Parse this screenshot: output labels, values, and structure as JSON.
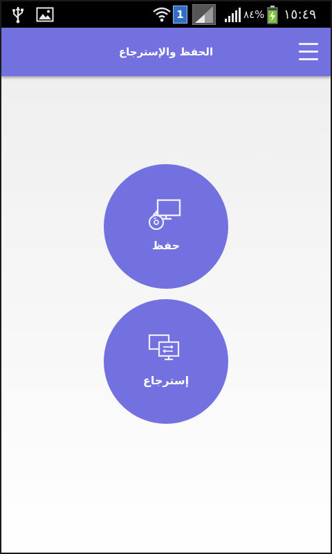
{
  "status_bar": {
    "time": "١٥:٤٩",
    "battery": "٨٤%",
    "notification_badge": "1",
    "icons": [
      "usb-icon",
      "image-icon",
      "wifi-icon",
      "sim-badge-icon",
      "signal-icon",
      "signal-icon",
      "battery-charging-icon"
    ]
  },
  "app_bar": {
    "title": "الحفظ والإسترجاع",
    "menu_icon": "hamburger-menu-icon",
    "color": "#7371e0"
  },
  "actions": [
    {
      "label": "حفظ",
      "icon": "backup-disc-monitor-icon"
    },
    {
      "label": "إسترجاع",
      "icon": "restore-monitors-icon"
    }
  ],
  "colors": {
    "accent": "#7371e0",
    "status_bar": "#000000",
    "battery_green": "#7cc63a",
    "badge_blue": "#2f6fc4"
  }
}
